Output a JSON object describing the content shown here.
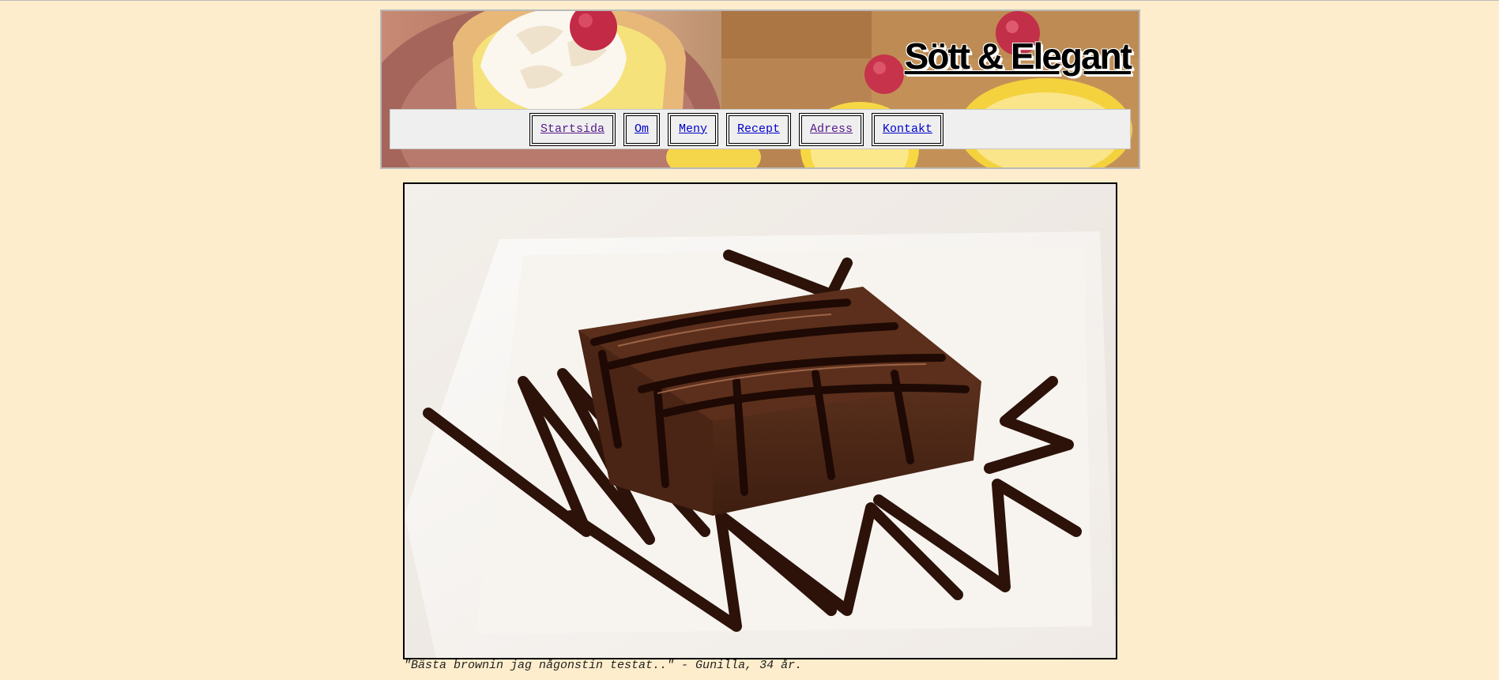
{
  "header": {
    "site_title": "Sött & Elegant",
    "image": "dessert-banner-photo"
  },
  "nav": {
    "items": [
      {
        "label": "Startsida",
        "visited": true
      },
      {
        "label": "Om"
      },
      {
        "label": "Meny"
      },
      {
        "label": "Recept"
      },
      {
        "label": "Adress",
        "visited": true
      },
      {
        "label": "Kontakt"
      }
    ]
  },
  "main": {
    "image": "brownie-chocolate-sauce-photo",
    "caption": "\"Bästa brownin jag någonstin testat..\" - Gunilla, 34 år."
  },
  "colors": {
    "page_background": "#feedcc",
    "nav_background": "#efefef",
    "link": "#0000cc",
    "visited_link": "#551a8b"
  }
}
